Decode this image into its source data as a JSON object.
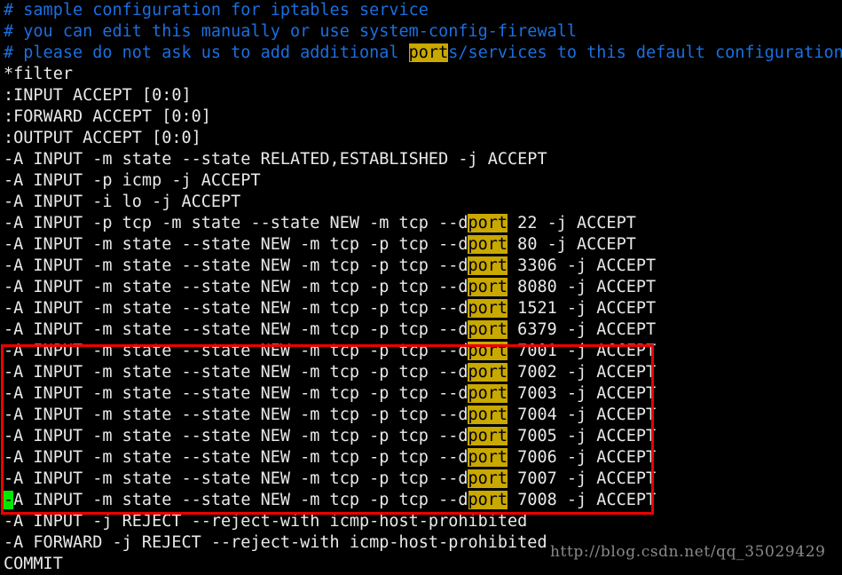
{
  "window": {
    "kind": "terminal-text-editor",
    "background_color": "#000000",
    "foreground_color": "#e9e9e9",
    "comment_color": "#1a6fe0",
    "highlight_bg_color": "#c9a800",
    "highlight_fg_color": "#000000",
    "cursor_color": "#00e800",
    "annotation_color": "#ee0000"
  },
  "search": {
    "term": "port",
    "highlight_label": "port"
  },
  "lines": [
    {
      "id": "line-1",
      "style": "comment",
      "segments": [
        {
          "text": "# sample configuration for iptables service"
        }
      ]
    },
    {
      "id": "line-2",
      "style": "comment",
      "segments": [
        {
          "text": "# you can edit this manually or use system-config-firewall"
        }
      ]
    },
    {
      "id": "line-3",
      "style": "comment",
      "segments": [
        {
          "text": "# please do not ask us to add additional "
        },
        {
          "text": "port",
          "hl": true
        },
        {
          "text": "s/services to this default configuration"
        }
      ]
    },
    {
      "id": "line-4",
      "style": "plain",
      "segments": [
        {
          "text": "*filter"
        }
      ]
    },
    {
      "id": "line-5",
      "style": "plain",
      "segments": [
        {
          "text": ":INPUT ACCEPT [0:0]"
        }
      ]
    },
    {
      "id": "line-6",
      "style": "plain",
      "segments": [
        {
          "text": ":FORWARD ACCEPT [0:0]"
        }
      ]
    },
    {
      "id": "line-7",
      "style": "plain",
      "segments": [
        {
          "text": ":OUTPUT ACCEPT [0:0]"
        }
      ]
    },
    {
      "id": "line-8",
      "style": "plain",
      "segments": [
        {
          "text": "-A INPUT -m state --state RELATED,ESTABLISHED -j ACCEPT"
        }
      ]
    },
    {
      "id": "line-9",
      "style": "plain",
      "segments": [
        {
          "text": "-A INPUT -p icmp -j ACCEPT"
        }
      ]
    },
    {
      "id": "line-10",
      "style": "plain",
      "segments": [
        {
          "text": "-A INPUT -i lo -j ACCEPT"
        }
      ]
    },
    {
      "id": "line-11",
      "style": "plain",
      "segments": [
        {
          "text": "-A INPUT -p tcp -m state --state NEW -m tcp --d"
        },
        {
          "text": "port",
          "hl": true
        },
        {
          "text": " 22 -j ACCEPT"
        }
      ]
    },
    {
      "id": "line-12",
      "style": "plain",
      "segments": [
        {
          "text": "-A INPUT -m state --state NEW -m tcp -p tcp --d"
        },
        {
          "text": "port",
          "hl": true
        },
        {
          "text": " 80 -j ACCEPT"
        }
      ]
    },
    {
      "id": "line-13",
      "style": "plain",
      "segments": [
        {
          "text": "-A INPUT -m state --state NEW -m tcp -p tcp --d"
        },
        {
          "text": "port",
          "hl": true
        },
        {
          "text": " 3306 -j ACCEPT"
        }
      ]
    },
    {
      "id": "line-14",
      "style": "plain",
      "segments": [
        {
          "text": "-A INPUT -m state --state NEW -m tcp -p tcp --d"
        },
        {
          "text": "port",
          "hl": true
        },
        {
          "text": " 8080 -j ACCEPT"
        }
      ]
    },
    {
      "id": "line-15",
      "style": "plain",
      "segments": [
        {
          "text": "-A INPUT -m state --state NEW -m tcp -p tcp --d"
        },
        {
          "text": "port",
          "hl": true
        },
        {
          "text": " 1521 -j ACCEPT"
        }
      ]
    },
    {
      "id": "line-16",
      "style": "plain",
      "segments": [
        {
          "text": "-A INPUT -m state --state NEW -m tcp -p tcp --d"
        },
        {
          "text": "port",
          "hl": true
        },
        {
          "text": " 6379 -j ACCEPT"
        }
      ]
    },
    {
      "id": "line-17",
      "style": "plain",
      "segments": [
        {
          "text": "-A INPUT -m state --state NEW -m tcp -p tcp --d"
        },
        {
          "text": "port",
          "hl": true
        },
        {
          "text": " 7001 -j ACCEPT"
        }
      ]
    },
    {
      "id": "line-18",
      "style": "plain",
      "segments": [
        {
          "text": "-A INPUT -m state --state NEW -m tcp -p tcp --d"
        },
        {
          "text": "port",
          "hl": true
        },
        {
          "text": " 7002 -j ACCEPT"
        }
      ]
    },
    {
      "id": "line-19",
      "style": "plain",
      "segments": [
        {
          "text": "-A INPUT -m state --state NEW -m tcp -p tcp --d"
        },
        {
          "text": "port",
          "hl": true
        },
        {
          "text": " 7003 -j ACCEPT"
        }
      ]
    },
    {
      "id": "line-20",
      "style": "plain",
      "segments": [
        {
          "text": "-A INPUT -m state --state NEW -m tcp -p tcp --d"
        },
        {
          "text": "port",
          "hl": true
        },
        {
          "text": " 7004 -j ACCEPT"
        }
      ]
    },
    {
      "id": "line-21",
      "style": "plain",
      "segments": [
        {
          "text": "-A INPUT -m state --state NEW -m tcp -p tcp --d"
        },
        {
          "text": "port",
          "hl": true
        },
        {
          "text": " 7005 -j ACCEPT"
        }
      ]
    },
    {
      "id": "line-22",
      "style": "plain",
      "segments": [
        {
          "text": "-A INPUT -m state --state NEW -m tcp -p tcp --d"
        },
        {
          "text": "port",
          "hl": true
        },
        {
          "text": " 7006 -j ACCEPT"
        }
      ]
    },
    {
      "id": "line-23",
      "style": "plain",
      "segments": [
        {
          "text": "-A INPUT -m state --state NEW -m tcp -p tcp --d"
        },
        {
          "text": "port",
          "hl": true
        },
        {
          "text": " 7007 -j ACCEPT"
        }
      ]
    },
    {
      "id": "line-24",
      "style": "plain",
      "segments": [
        {
          "text": "-",
          "cursor": true
        },
        {
          "text": "A INPUT -m state --state NEW -m tcp -p tcp --d"
        },
        {
          "text": "port",
          "hl": true
        },
        {
          "text": " 7008 -j ACCEPT"
        }
      ]
    },
    {
      "id": "line-25",
      "style": "plain",
      "segments": [
        {
          "text": "-A INPUT -j REJECT --reject-with icmp-host-prohibited"
        }
      ]
    },
    {
      "id": "line-26",
      "style": "plain",
      "segments": [
        {
          "text": "-A FORWARD -j REJECT --reject-with icmp-host-prohibited"
        }
      ]
    },
    {
      "id": "line-27",
      "style": "plain",
      "segments": [
        {
          "text": "COMMIT"
        }
      ]
    }
  ],
  "annotation": {
    "label": "red-highlight-rectangle",
    "covers_lines": "7001 through 7008 dport rules"
  },
  "watermark": {
    "text": "http://blog.csdn.net/qq_35029429"
  }
}
